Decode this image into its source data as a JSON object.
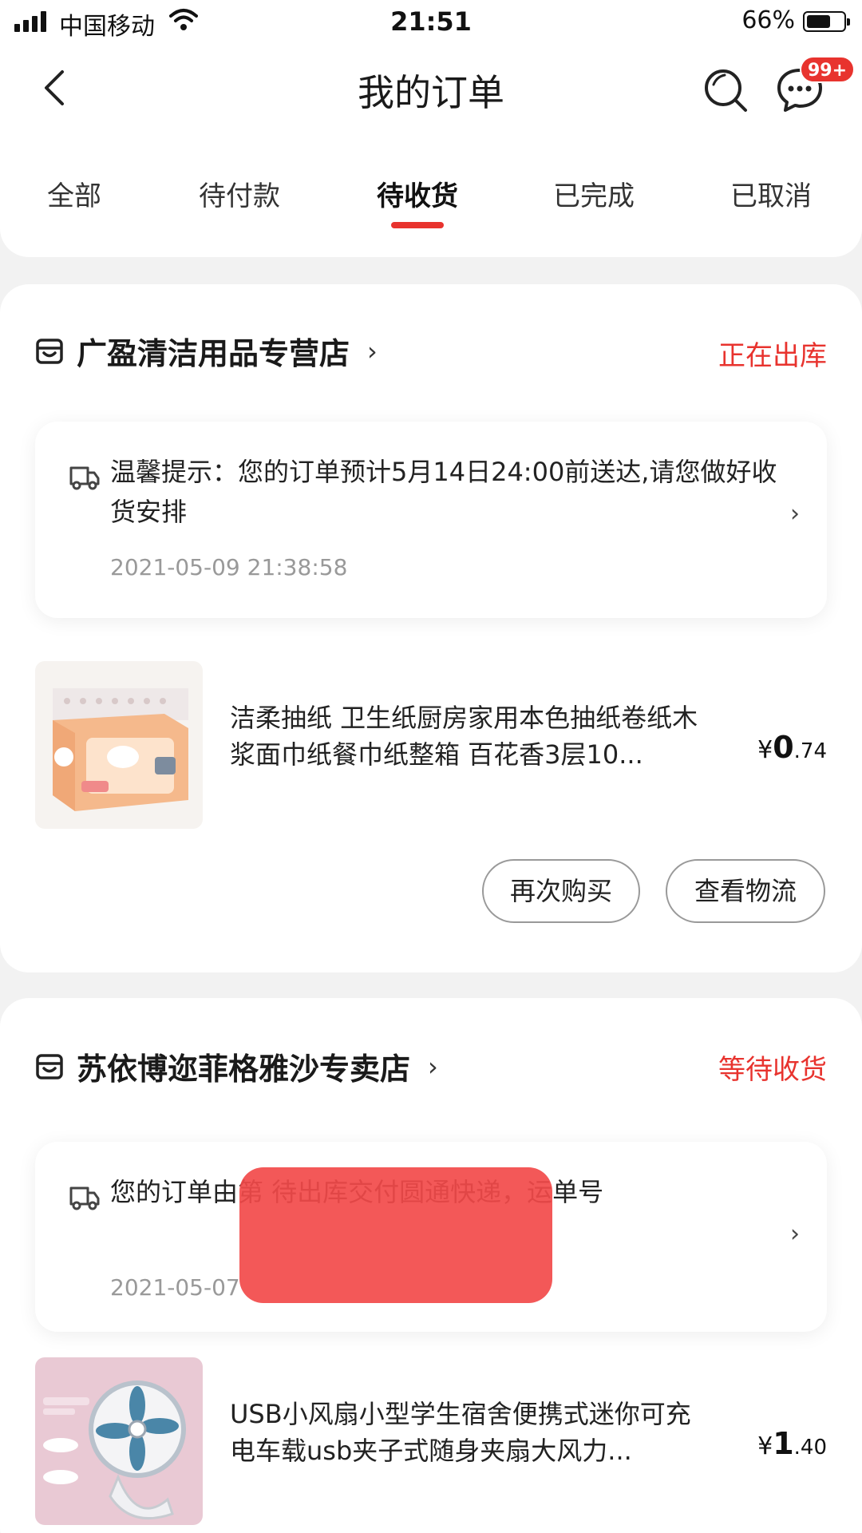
{
  "status_bar": {
    "carrier": "中国移动",
    "time": "21:51",
    "battery_pct": "66%",
    "battery_level": 0.66
  },
  "nav": {
    "title": "我的订单",
    "badge": "99+",
    "icons": [
      "back-arrow-icon",
      "search-icon",
      "message-icon"
    ]
  },
  "tabs": [
    {
      "label": "全部"
    },
    {
      "label": "待付款"
    },
    {
      "label": "待收货"
    },
    {
      "label": "已完成"
    },
    {
      "label": "已取消"
    }
  ],
  "active_tab": 2,
  "orders": [
    {
      "shop_name": "广盈清洁用品专营店",
      "status": "正在出库",
      "notice_text": "温馨提示：您的订单预计5月14日24:00前送达,请您做好收货安排",
      "notice_time": "2021-05-09 21:38:58",
      "product_title": "洁柔抽纸 卫生纸厨房家用本色抽纸卷纸木浆面巾纸餐巾纸整箱 百花香3层10...",
      "price_currency": "¥",
      "price_int": "0",
      "price_dec": ".74",
      "buttons": [
        "再次购买",
        "查看物流"
      ]
    },
    {
      "shop_name": "苏依博迩菲格雅沙专卖店",
      "status": "等待收货",
      "notice_text": "您的订单由第 待出库交付圆通快递，运单号",
      "notice_time": "2021-05-07",
      "product_title": "USB小风扇小型学生宿舍便携式迷你可充电车载usb夹子式随身夹扇大风力...",
      "price_currency": "¥",
      "price_int": "1",
      "price_dec": ".40"
    }
  ],
  "colors": {
    "accent": "#e8332e",
    "background": "#f2f2f2"
  }
}
